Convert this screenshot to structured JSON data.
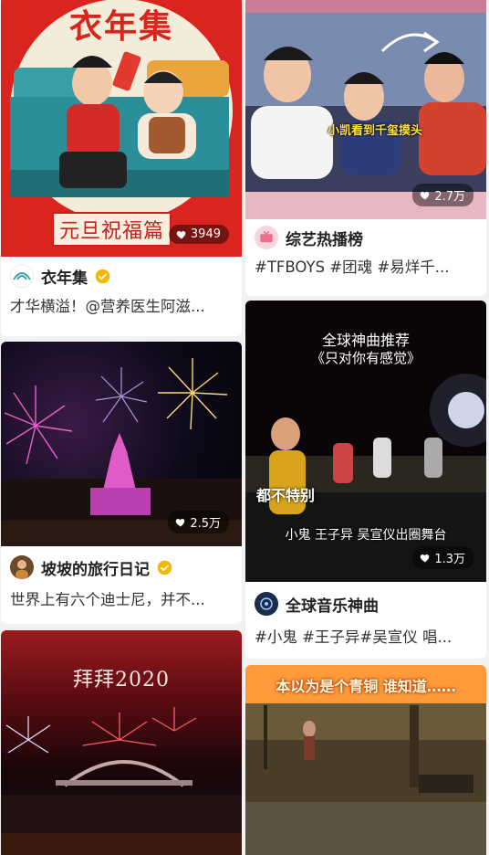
{
  "colors": {
    "background": "#f2f2f2",
    "verified_gold": "#f5b700",
    "like_badge_bg": "rgba(0,0,0,0.45)"
  },
  "cards": {
    "newyear": {
      "overlay_title": "衣年集",
      "overlay_sub": "元旦祝福篇",
      "likes": "3949",
      "author": "衣年集",
      "verified": true,
      "caption": "才华横溢！@营养医生阿滋..."
    },
    "show": {
      "overlay_sub": "小凯看到千玺摸头",
      "likes": "2.7万",
      "author": "综艺热播榜",
      "verified": false,
      "caption": "#TFBOYS #团魂 #易烊千..."
    },
    "fireworks": {
      "likes": "2.5万",
      "author": "坡坡的旅行日记",
      "verified": true,
      "caption": "世界上有六个迪士尼，并不..."
    },
    "music": {
      "overlay_title": "全球神曲推荐",
      "overlay_sub": "《只对你有感觉》",
      "overlay_tag": "都不特别",
      "overlay_bottom": "小鬼  王子异  吴宣仪出圈舞台",
      "likes": "1.3万",
      "author": "全球音乐神曲",
      "verified": false,
      "caption": "#小鬼 #王子异#吴宣仪 唱..."
    },
    "sydney": {
      "overlay_title": "拜拜2020"
    },
    "bronze": {
      "overlay_title": "本以为是个青铜 谁知道……"
    }
  },
  "icons": {
    "heart": "heart-icon",
    "verified": "verified-badge-icon"
  }
}
